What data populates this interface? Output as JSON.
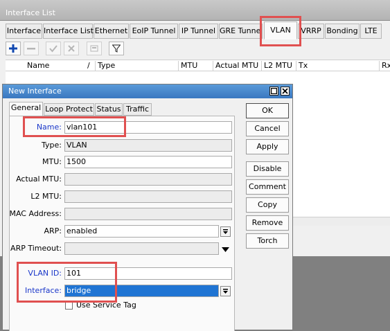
{
  "window": {
    "title": "Interface List",
    "tabs": [
      "Interface",
      "Interface List",
      "Ethernet",
      "EoIP Tunnel",
      "IP Tunnel",
      "GRE Tunnel",
      "VLAN",
      "VRRP",
      "Bonding",
      "LTE"
    ],
    "active_tab": "VLAN",
    "columns": [
      "Name",
      "/",
      "Type",
      "MTU",
      "Actual MTU",
      "L2 MTU",
      "Tx",
      "Rx"
    ],
    "toolbar_icons": [
      "add-icon",
      "remove-icon",
      "enable-icon",
      "disable-icon",
      "comment-icon",
      "filter-icon"
    ]
  },
  "dialog": {
    "title": "New Interface",
    "tabs": [
      "General",
      "Loop Protect",
      "Status",
      "Traffic"
    ],
    "active_tab": "General",
    "fields": {
      "name": {
        "label": "Name:",
        "value": "vlan101"
      },
      "type": {
        "label": "Type:",
        "value": "VLAN"
      },
      "mtu": {
        "label": "MTU:",
        "value": "1500"
      },
      "actual_mtu": {
        "label": "Actual MTU:",
        "value": ""
      },
      "l2_mtu": {
        "label": "L2 MTU:",
        "value": ""
      },
      "mac_address": {
        "label": "MAC Address:",
        "value": ""
      },
      "arp": {
        "label": "ARP:",
        "value": "enabled"
      },
      "arp_timeout": {
        "label": "ARP Timeout:",
        "value": ""
      },
      "vlan_id": {
        "label": "VLAN ID:",
        "value": "101"
      },
      "interface": {
        "label": "Interface:",
        "value": "bridge"
      },
      "use_service_tag": {
        "label": "Use Service Tag",
        "checked": false
      }
    },
    "buttons": [
      "OK",
      "Cancel",
      "Apply",
      "Disable",
      "Comment",
      "Copy",
      "Remove",
      "Torch"
    ]
  },
  "colors": {
    "highlight": "#e05050",
    "field_label_blue": "#1a37c9",
    "selection": "#1f74d3",
    "dialog_title": "#3a78c0"
  }
}
